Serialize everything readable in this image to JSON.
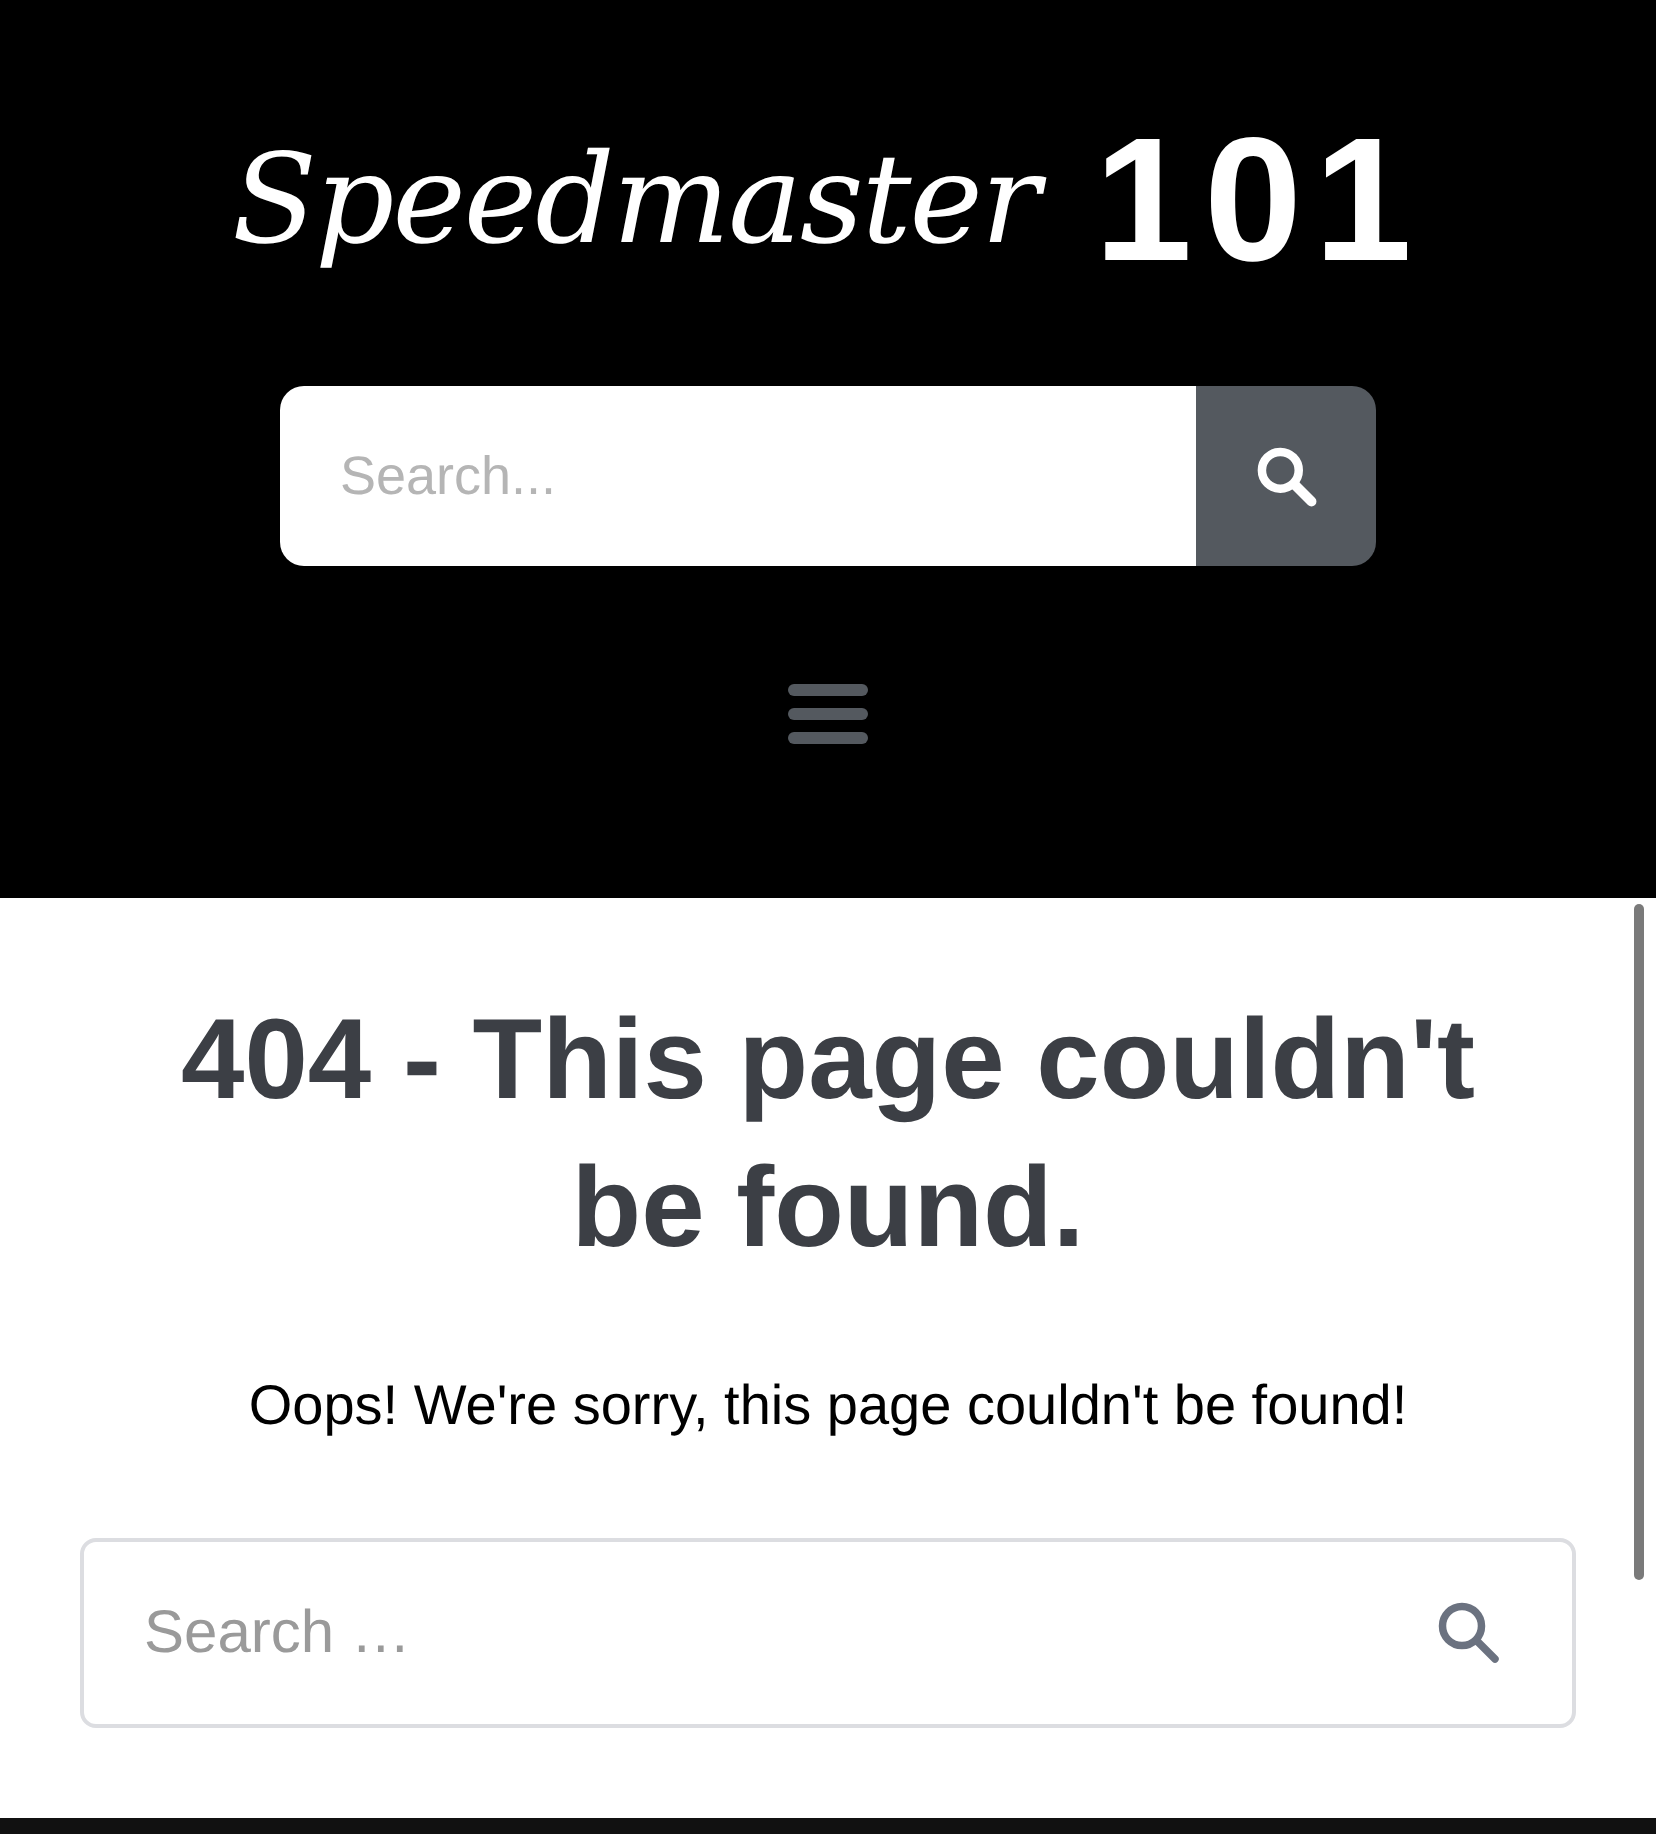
{
  "header": {
    "logo_script": "Speedmaster",
    "logo_number": "101",
    "search": {
      "placeholder": "Search..."
    }
  },
  "main": {
    "title": "404 - This page couldn't be found.",
    "message": "Oops! We're sorry, this page couldn't be found!",
    "search": {
      "placeholder": "Search …"
    }
  }
}
